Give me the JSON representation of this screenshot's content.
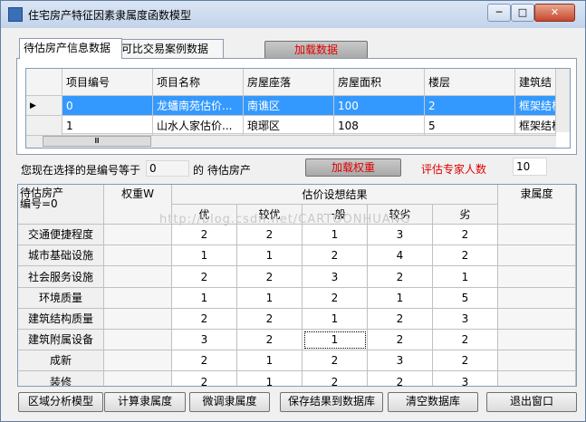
{
  "window": {
    "title": "住宅房产特征因素隶属度函数模型",
    "min": "─",
    "max": "□",
    "close": "✕"
  },
  "tabs": [
    "待估房产信息数据",
    "可比交易案例数据"
  ],
  "load_data_button": "加载数据",
  "grid1": {
    "headers": [
      "项目编号",
      "项目名称",
      "房屋座落",
      "房屋面积",
      "楼层",
      "建筑结"
    ],
    "rows": [
      [
        "0",
        "龙蟠南苑估价...",
        "南谯区",
        "100",
        "2",
        "框架结构"
      ],
      [
        "1",
        "山水人家估价...",
        "琅琊区",
        "108",
        "5",
        "框架结构"
      ]
    ],
    "hscroll_thumb": "Ⅲ"
  },
  "selection": {
    "prefix": "您现在选择的是编号等于",
    "value": "0",
    "suffix": "的 待估房产"
  },
  "load_weight_button": "加载权重",
  "expert_label": "评估专家人数",
  "expert_count": "10",
  "grid2": {
    "corner": "待估房产\n编号=0",
    "weight_header": "权重W",
    "group_header": "估价设想结果",
    "membership_header": "隶属度",
    "sub_headers": [
      "优",
      "较优",
      "一般",
      "较劣",
      "劣"
    ],
    "rows": [
      {
        "label": "交通便捷程度",
        "values": [
          "2",
          "2",
          "1",
          "3",
          "2"
        ]
      },
      {
        "label": "城市基础设施",
        "values": [
          "1",
          "1",
          "2",
          "4",
          "2"
        ]
      },
      {
        "label": "社会服务设施",
        "values": [
          "2",
          "2",
          "3",
          "2",
          "1"
        ]
      },
      {
        "label": "环境质量",
        "values": [
          "1",
          "1",
          "2",
          "1",
          "5"
        ]
      },
      {
        "label": "建筑结构质量",
        "values": [
          "2",
          "2",
          "1",
          "2",
          "3"
        ]
      },
      {
        "label": "建筑附属设备",
        "values": [
          "3",
          "2",
          "1",
          "2",
          "2"
        ]
      },
      {
        "label": "成新",
        "values": [
          "2",
          "1",
          "2",
          "3",
          "2"
        ]
      },
      {
        "label": "装修",
        "values": [
          "2",
          "1",
          "2",
          "2",
          "3"
        ]
      }
    ]
  },
  "watermark": "http://blog.csdn.net/CARTOONHUANG",
  "buttons": [
    "区域分析模型",
    "计算隶属度",
    "微调隶属度",
    "保存结果到数据库",
    "清空数据库",
    "退出窗口"
  ]
}
